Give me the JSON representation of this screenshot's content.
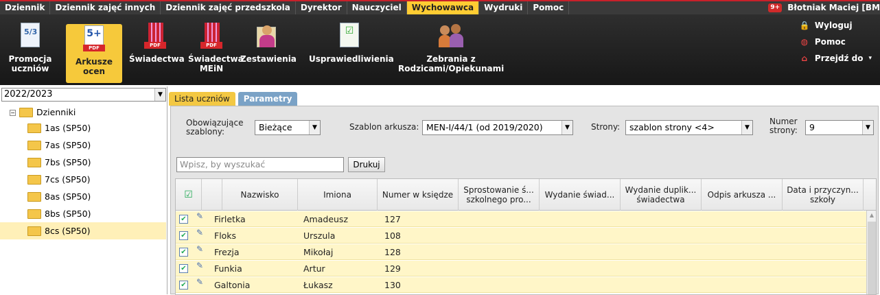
{
  "menu": {
    "items": [
      "Dziennik",
      "Dziennik zajęć innych",
      "Dziennik zajęć przedszkola",
      "Dyrektor",
      "Nauczyciel",
      "Wychowawca",
      "Wydruki",
      "Pomoc"
    ],
    "active_index": 5,
    "user": "Błotniak Maciej [BM",
    "notif_badge": "9+"
  },
  "toolbar": {
    "buttons": [
      {
        "label": "Promocja uczniów",
        "icon": "promotion-sheet-icon"
      },
      {
        "label": "Arkusze ocen",
        "icon": "grades-pdf-icon",
        "badge": "5+",
        "pdf": "PDF",
        "active": true
      },
      {
        "label": "Świadectwa",
        "icon": "certificate-pdf-icon",
        "pdf": "PDF"
      },
      {
        "label": "Świadectwa MEiN",
        "icon": "certificate-mein-pdf-icon",
        "pdf": "PDF"
      },
      {
        "label": "Zestawienia",
        "icon": "report-person-icon"
      },
      {
        "label": "Usprawiedliwienia",
        "icon": "excuse-checklist-icon"
      },
      {
        "label": "Zebrania z Rodzicami/Opiekunami",
        "icon": "parents-meeting-icon"
      }
    ],
    "right_links": [
      {
        "label": "Wyloguj",
        "icon": "lock-icon"
      },
      {
        "label": "Pomoc",
        "icon": "lifebuoy-icon"
      },
      {
        "label": "Przejdź do",
        "icon": "home-icon"
      }
    ]
  },
  "left": {
    "year": "2022/2023",
    "root": "Dzienniki",
    "root_expander": "−",
    "classes": [
      "1as (SP50)",
      "7as (SP50)",
      "7bs (SP50)",
      "7cs (SP50)",
      "8as (SP50)",
      "8bs (SP50)",
      "8cs (SP50)"
    ],
    "selected_index": 6
  },
  "tabs": [
    "Lista uczniów",
    "Parametry"
  ],
  "filters": {
    "templates_label": "Obowiązujące szablony:",
    "templates_value": "Bieżące",
    "sheet_label": "Szablon arkusza:",
    "sheet_value": "MEN-I/44/1 (od 2019/2020)",
    "pages_label": "Strony:",
    "pages_value": "szablon strony <4>",
    "pagenum_label": "Numer strony:",
    "pagenum_value": "9"
  },
  "search": {
    "placeholder": "Wpisz, by wyszukać",
    "print_label": "Drukuj"
  },
  "table": {
    "columns": [
      "Nazwisko",
      "Imiona",
      "Numer w księdze",
      "Sprostowanie ś... szkolnego pro...",
      "Wydanie świad...",
      "Wydanie duplik... świadectwa",
      "Odpis arkusza ...",
      "Data i przyczyn... szkoły"
    ],
    "rows": [
      {
        "surname": "Firletka",
        "names": "Amadeusz",
        "number": "127"
      },
      {
        "surname": "Floks",
        "names": "Urszula",
        "number": "108"
      },
      {
        "surname": "Frezja",
        "names": "Mikołaj",
        "number": "128"
      },
      {
        "surname": "Funkia",
        "names": "Artur",
        "number": "129"
      },
      {
        "surname": "Galtonia",
        "names": "Łukasz",
        "number": "130"
      }
    ]
  }
}
